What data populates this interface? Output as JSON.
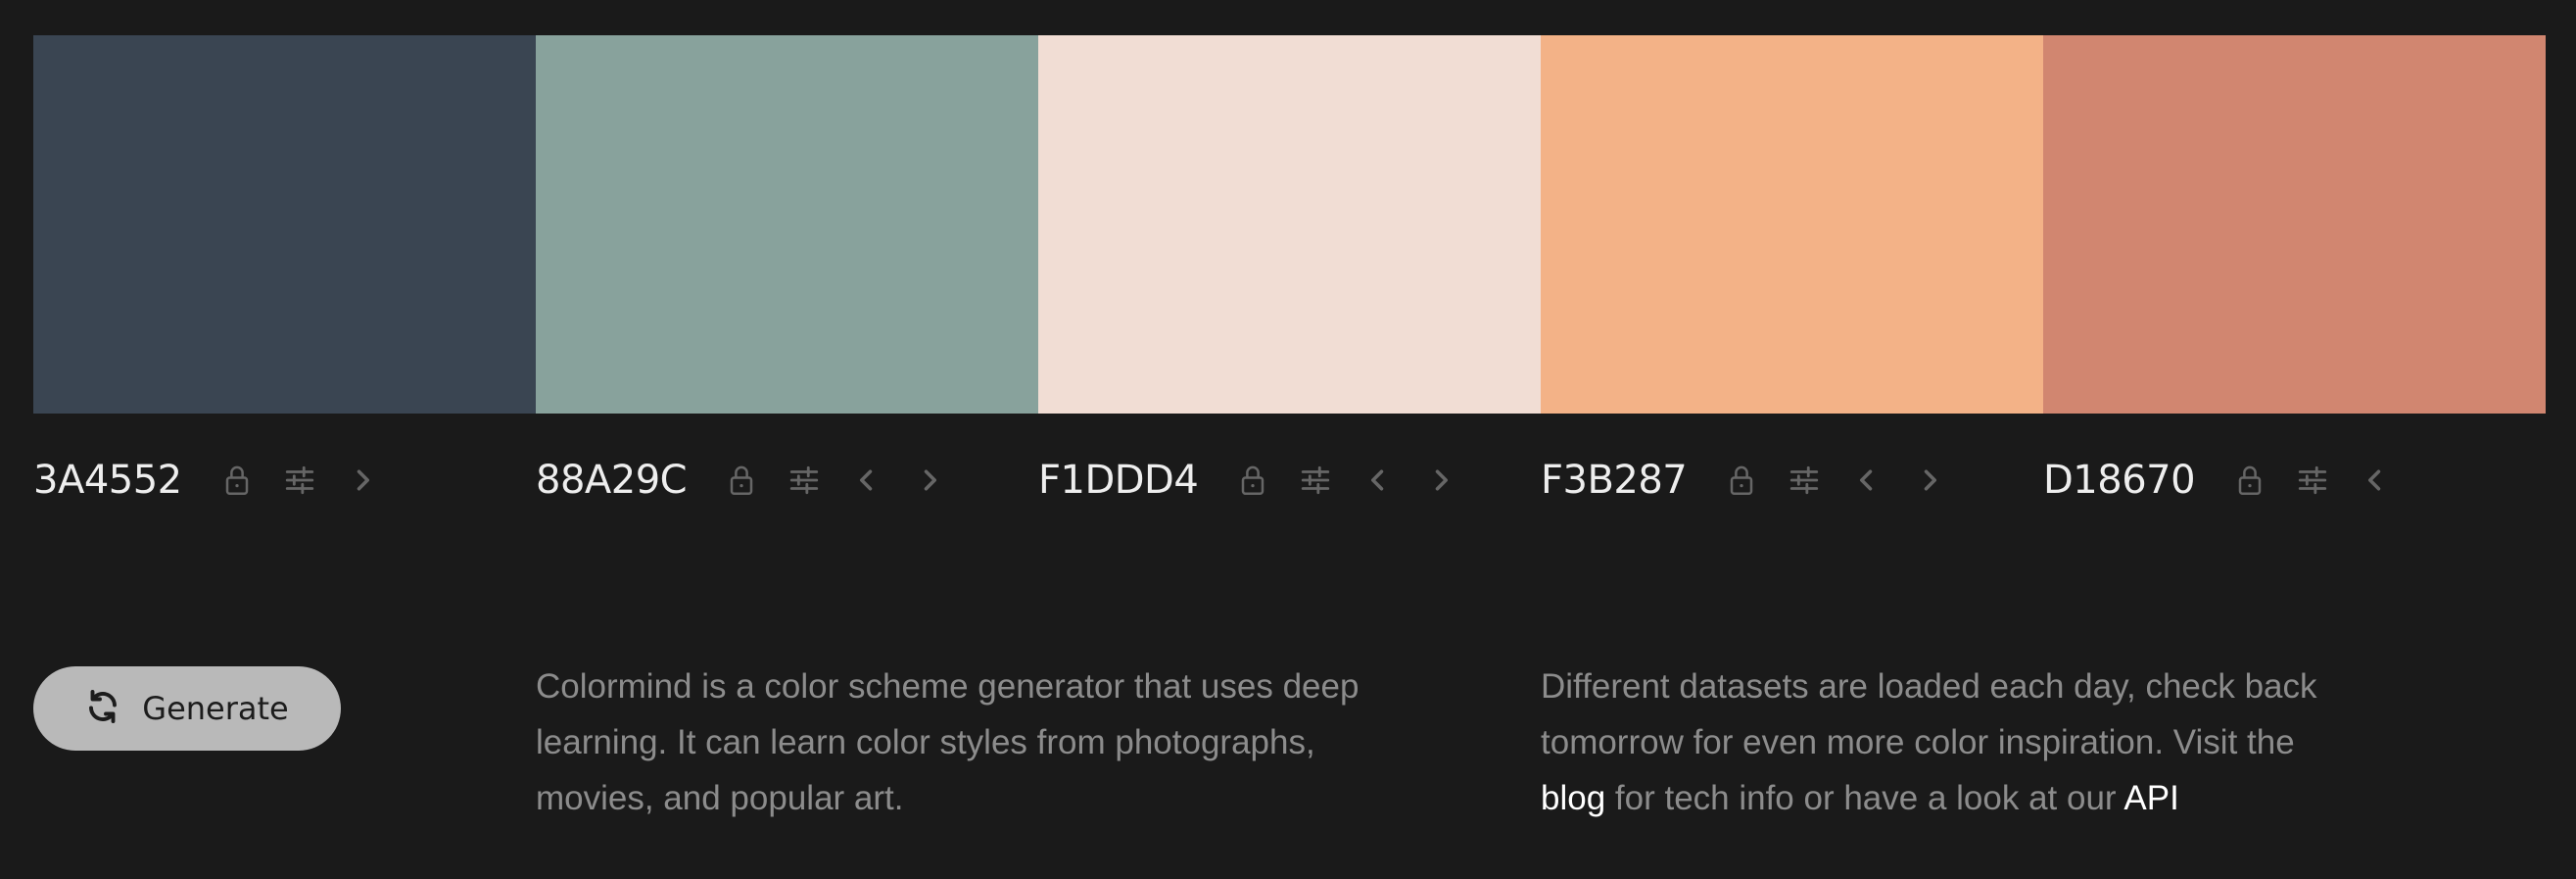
{
  "palette": {
    "colors": [
      {
        "hex": "3A4552",
        "swatch": "#3A4552",
        "has_prev": false,
        "has_next": true
      },
      {
        "hex": "88A29C",
        "swatch": "#88A29C",
        "has_prev": true,
        "has_next": true
      },
      {
        "hex": "F1DDD4",
        "swatch": "#F1DDD4",
        "has_prev": true,
        "has_next": true
      },
      {
        "hex": "F3B287",
        "swatch": "#F3B287",
        "has_prev": true,
        "has_next": true
      },
      {
        "hex": "D18670",
        "swatch": "#D18670",
        "has_prev": true,
        "has_next": false
      }
    ],
    "icon_color": "#666666"
  },
  "generate": {
    "label": "Generate",
    "icon": "refresh-icon"
  },
  "about": {
    "line1": "Colormind is a color scheme generator that uses deep",
    "line2": "learning. It can learn color styles from photographs,",
    "line3": "movies, and popular art."
  },
  "info": {
    "line1": "Different datasets are loaded each day, check back",
    "line2": "tomorrow for even more color inspiration. Visit the",
    "blog_link": "blog",
    "line3_mid": " for tech info or have a look at our ",
    "api_link": "API"
  }
}
